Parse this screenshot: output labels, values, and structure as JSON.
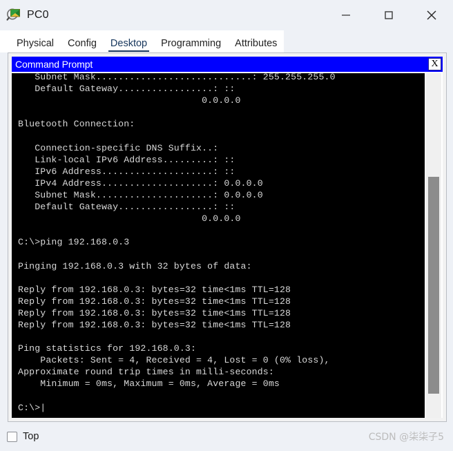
{
  "window": {
    "title": "PC0",
    "icon": "packet-tracer-pc-icon",
    "controls": {
      "minimize": "minimize-icon",
      "maximize": "maximize-icon",
      "close": "close-icon"
    }
  },
  "tabs": [
    {
      "label": "Physical",
      "active": false
    },
    {
      "label": "Config",
      "active": false
    },
    {
      "label": "Desktop",
      "active": true
    },
    {
      "label": "Programming",
      "active": false
    },
    {
      "label": "Attributes",
      "active": false
    }
  ],
  "command_prompt": {
    "title": "Command Prompt",
    "close_label": "X",
    "scroll_position_percent": 30,
    "terminal_text": "   Subnet Mask............................: 255.255.255.0\n   Default Gateway.................: ::\n                                 0.0.0.0\n\nBluetooth Connection:\n\n   Connection-specific DNS Suffix..:\n   Link-local IPv6 Address.........: ::\n   IPv6 Address....................: ::\n   IPv4 Address....................: 0.0.0.0\n   Subnet Mask.....................: 0.0.0.0\n   Default Gateway.................: ::\n                                 0.0.0.0\n\nC:\\>ping 192.168.0.3\n\nPinging 192.168.0.3 with 32 bytes of data:\n\nReply from 192.168.0.3: bytes=32 time<1ms TTL=128\nReply from 192.168.0.3: bytes=32 time<1ms TTL=128\nReply from 192.168.0.3: bytes=32 time<1ms TTL=128\nReply from 192.168.0.3: bytes=32 time<1ms TTL=128\n\nPing statistics for 192.168.0.3:\n    Packets: Sent = 4, Received = 4, Lost = 0 (0% loss),\nApproximate round trip times in milli-seconds:\n    Minimum = 0ms, Maximum = 0ms, Average = 0ms\n\nC:\\>|",
    "ping_target": "192.168.0.3",
    "ping_bytes": "32",
    "ping_ttl": "128",
    "ping_time": "<1ms",
    "packets_sent": "4",
    "packets_received": "4",
    "packets_lost": "0",
    "loss_percent": "0%",
    "rtt_minimum": "0ms",
    "rtt_maximum": "0ms",
    "rtt_average": "0ms",
    "prompt": "C:\\>"
  },
  "footer": {
    "top_label": "Top",
    "top_checked": false,
    "watermark": "CSDN @柒柒子5"
  },
  "colors": {
    "cmd_titlebar": "#0000ff",
    "terminal_bg": "#000000",
    "terminal_fg": "#d8d8d8",
    "tab_active": "#16365c",
    "window_bg": "#eef1f6"
  }
}
